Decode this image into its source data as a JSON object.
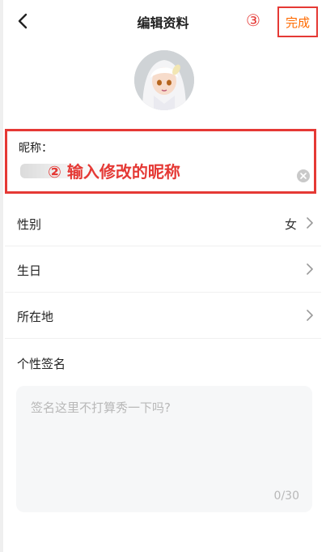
{
  "header": {
    "title": "编辑资料",
    "step_marker": "③",
    "done_label": "完成"
  },
  "nickname": {
    "label": "昵称：",
    "annotation": "② 输入修改的昵称"
  },
  "rows": [
    {
      "label": "性别",
      "value": "女"
    },
    {
      "label": "生日",
      "value": ""
    },
    {
      "label": "所在地",
      "value": ""
    }
  ],
  "signature": {
    "title": "个性签名",
    "placeholder": "签名这里不打算秀一下吗?",
    "counter": "0/30"
  },
  "colors": {
    "accent_orange": "#ff6a00",
    "annotation_red": "#e53935"
  }
}
